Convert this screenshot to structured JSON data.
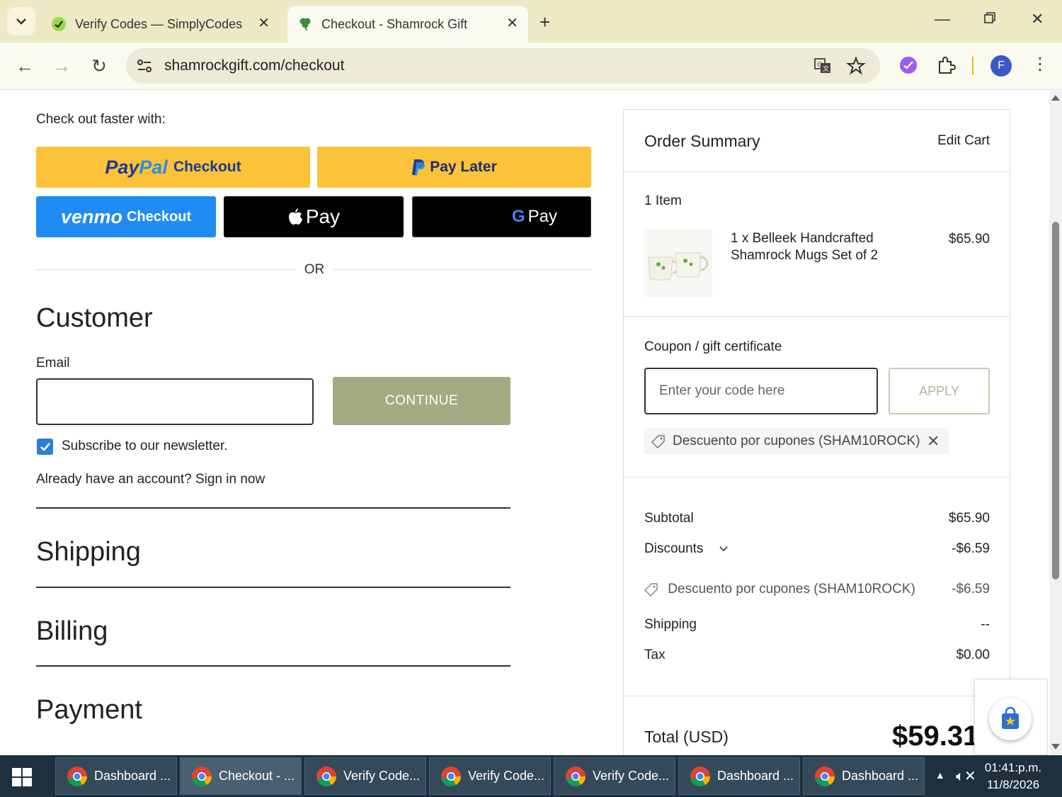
{
  "browser": {
    "tabs": [
      {
        "title": "Verify Codes — SimplyCodes",
        "active": false
      },
      {
        "title": "Checkout - Shamrock Gift",
        "active": true
      }
    ],
    "url": "shamrockgift.com/checkout",
    "profile_initial": "F"
  },
  "checkout": {
    "faster_label": "Check out faster with:",
    "paypal": {
      "word1": "Pay",
      "word2": "Pal",
      "sub": "Checkout"
    },
    "paylater_label": "Pay Later",
    "venmo": {
      "word": "venmo",
      "sub": "Checkout"
    },
    "applepay_label": "Pay",
    "gpay": {
      "g": "G",
      "label": "Pay"
    },
    "or_label": "OR",
    "customer_heading": "Customer",
    "email_label": "Email",
    "email_value": "",
    "continue_label": "CONTINUE",
    "newsletter_label": "Subscribe to our newsletter.",
    "newsletter_checked": true,
    "signin_text": "Already have an account? Sign in now",
    "shipping_heading": "Shipping",
    "billing_heading": "Billing",
    "payment_heading": "Payment"
  },
  "summary": {
    "title": "Order Summary",
    "edit_cart": "Edit Cart",
    "item_count": "1 Item",
    "product": {
      "name": "1 x Belleek Handcrafted Shamrock Mugs Set of 2",
      "price": "$65.90"
    },
    "coupon_label": "Coupon / gift certificate",
    "coupon_placeholder": "Enter your code here",
    "apply_label": "APPLY",
    "applied_coupon": "Descuento por cupones (SHAM10ROCK)",
    "subtotal": {
      "label": "Subtotal",
      "value": "$65.90"
    },
    "discounts": {
      "label": "Discounts",
      "value": "-$6.59"
    },
    "discount_detail": {
      "label": "Descuento por cupones (SHAM10ROCK)",
      "value": "-$6.59"
    },
    "shipping": {
      "label": "Shipping",
      "value": "--"
    },
    "tax": {
      "label": "Tax",
      "value": "$0.00"
    },
    "total": {
      "label": "Total (USD)",
      "value": "$59.31"
    }
  },
  "taskbar": {
    "items": [
      {
        "label": "Dashboard ...",
        "active": false
      },
      {
        "label": "Checkout - ...",
        "active": true
      },
      {
        "label": "Verify Code...",
        "active": false
      },
      {
        "label": "Verify Code...",
        "active": false
      },
      {
        "label": "Verify Code...",
        "active": false
      },
      {
        "label": "Dashboard ...",
        "active": false
      },
      {
        "label": "Dashboard ...",
        "active": false
      }
    ],
    "time": "01:41:p.m.",
    "date": "11/8/2026"
  },
  "colors": {
    "paypal_yellow": "#fbc23a",
    "venmo_blue": "#1e8cf2",
    "continue_olive": "#a4aa82",
    "checkbox_blue": "#2b7fd9"
  }
}
